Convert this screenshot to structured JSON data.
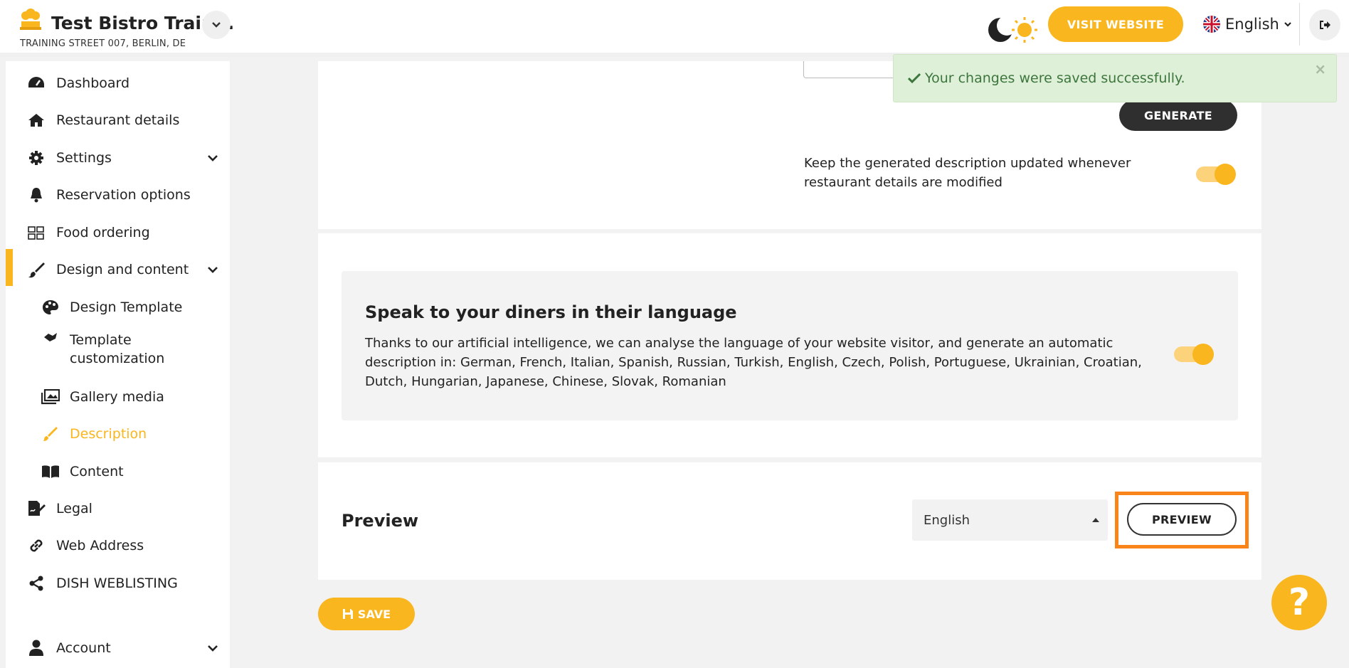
{
  "header": {
    "brand_name": "Test Bistro Train...",
    "brand_address": "TRAINING STREET 007, BERLIN, DE",
    "visit_website": "VISIT WEBSITE",
    "language": "English"
  },
  "sidebar": {
    "items": [
      {
        "label": "Dashboard",
        "icon": "dashboard-icon"
      },
      {
        "label": "Restaurant details",
        "icon": "home-icon"
      },
      {
        "label": "Settings",
        "icon": "gear-icon"
      },
      {
        "label": "Reservation options",
        "icon": "bell-icon"
      },
      {
        "label": "Food ordering",
        "icon": "food-ordering-icon"
      },
      {
        "label": "Design and content",
        "icon": "brush-icon"
      },
      {
        "label": "Design Template",
        "icon": "palette-icon"
      },
      {
        "label": "Template customization",
        "icon": "template-customization-icon"
      },
      {
        "label": "Gallery media",
        "icon": "gallery-icon"
      },
      {
        "label": "Description",
        "icon": "pencil-icon"
      },
      {
        "label": "Content",
        "icon": "book-icon"
      },
      {
        "label": "Legal",
        "icon": "legal-icon"
      },
      {
        "label": "Web Address",
        "icon": "link-icon"
      },
      {
        "label": "DISH WEBLISTING",
        "icon": "share-icon"
      },
      {
        "label": "Account",
        "icon": "user-icon"
      }
    ]
  },
  "description_card": {
    "generate_label": "GENERATE",
    "keep_updated_text": "Keep the generated description updated whenever restaurant details are modified",
    "keep_updated_on": true
  },
  "language_card": {
    "title": "Speak to your diners in their language",
    "body": "Thanks to our artificial intelligence, we can analyse the language of your website visitor, and generate an automatic description in: German, French, Italian, Spanish, Russian, Turkish, English, Czech, Polish, Portuguese, Ukrainian, Croatian, Dutch, Hungarian, Japanese, Chinese, Slovak, Romanian",
    "enabled": true
  },
  "preview_card": {
    "title": "Preview",
    "language_value": "English",
    "preview_label": "PREVIEW"
  },
  "save_label": "SAVE",
  "toast": {
    "message": "Your changes were saved successfully.",
    "close": "×"
  },
  "help": "?",
  "colors": {
    "accent": "#f9b61e",
    "highlight": "#f9851a",
    "success_bg": "#dff0d8",
    "success_text": "#3c763d"
  }
}
